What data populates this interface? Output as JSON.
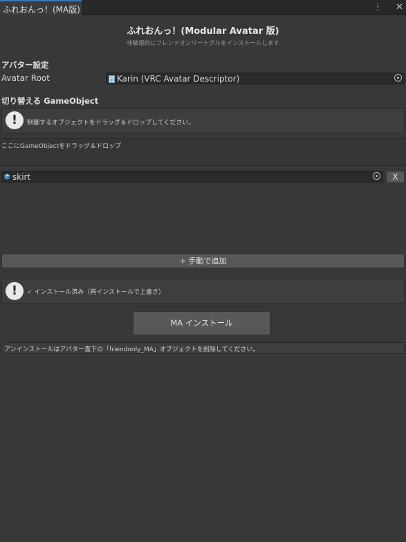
{
  "window": {
    "tab_title": "ふれおんっ！(MA版)"
  },
  "header": {
    "title": "ふれおんっ！(Modular Avatar 版)",
    "subtitle": "非破壊的にフレンドオンリートグルをインストールします"
  },
  "avatar": {
    "section": "アバター設定",
    "root_label": "Avatar Root",
    "root_value": "Karin (VRC Avatar Descriptor)"
  },
  "toggle": {
    "section": "切り替える GameObject",
    "help": "制御するオブジェクトをドラッグ＆ドロップしてください。",
    "dropzone": "ここにGameObjectをドラッグ＆ドロップ",
    "items": [
      {
        "name": "skirt",
        "remove": "X"
      }
    ],
    "add_manual": "+ 手動で追加"
  },
  "status": {
    "text": "✓ インストール済み（再インストールで上書き）"
  },
  "install": {
    "button": "MA インストール",
    "uninstall_note": "アンインストールはアバター直下の「friendonly_MA」オブジェクトを削除してください。"
  },
  "icons": {
    "help": "exclamation-icon",
    "menu": "kebab-menu-icon",
    "close": "close-icon"
  },
  "colors": {
    "accent": "#3a79bb",
    "background": "#383838",
    "field": "#2a2a2a"
  }
}
